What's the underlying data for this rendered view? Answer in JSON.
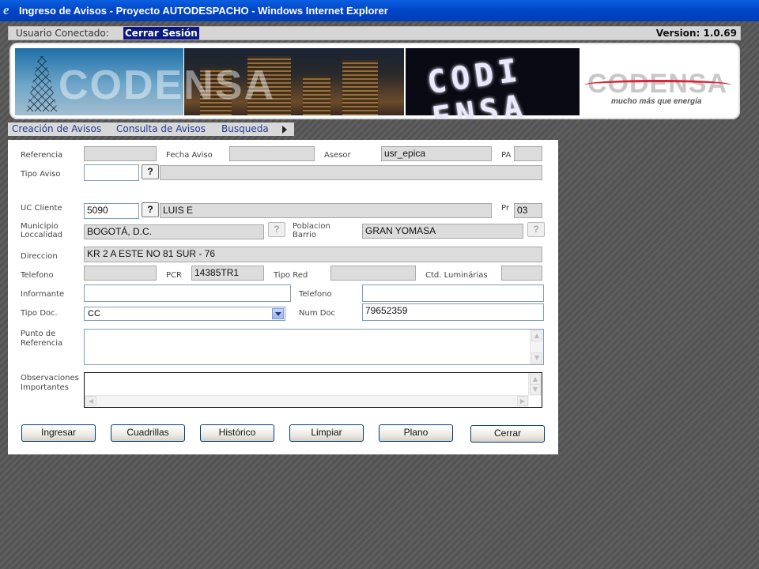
{
  "window": {
    "title": "Ingreso de Avisos - Proyecto AUTODESPACHO - Windows Internet Explorer"
  },
  "userbar": {
    "user_label": "Usuario Conectado:",
    "logout_label": "Cerrar Sesión",
    "version": "Version: 1.0.69"
  },
  "banner": {
    "watermark": "CODENSA",
    "led_text": "CODI ENSA",
    "logo_text": "CODENSA",
    "slogan": "mucho más que energía"
  },
  "menu": {
    "items": [
      "Creación de Avisos",
      "Consulta de Avisos",
      "Busqueda"
    ]
  },
  "form": {
    "labels": {
      "referencia": "Referencia",
      "fecha_aviso": "Fecha Aviso",
      "asesor": "Asesor",
      "pa": "PA",
      "tipo_aviso": "Tipo Aviso",
      "uc_cliente": "UC Cliente",
      "pr": "Pr",
      "municipio": "Municipio",
      "localidad": "Loccalidad",
      "poblacion": "Poblacion",
      "barrio": "Barrio",
      "direccion": "Direccion",
      "telefono": "Telefono",
      "pcr": "PCR",
      "tipo_red": "Tipo Red",
      "ctd_luminarias": "Ctd. Luminárias",
      "informante": "Informante",
      "telefono2": "Telefono",
      "tipo_doc": "Tipo Doc.",
      "num_doc": "Num Doc",
      "punto_ref_1": "Punto de",
      "punto_ref_2": "Referencia",
      "obs_1": "Observaciones",
      "obs_2": "Importantes"
    },
    "values": {
      "referencia": "",
      "fecha_aviso": "",
      "asesor": "usr_epica",
      "pa": "",
      "tipo_aviso": "",
      "tipo_aviso_desc": "",
      "uc_cliente": "5090",
      "cliente_nombre": "LUIS E",
      "pr": "03",
      "municipio": "BOGOTÁ, D.C.",
      "barrio": "GRAN YOMASA",
      "direccion": "KR 2 A ESTE NO 81 SUR - 76",
      "telefono": "",
      "pcr": "14385TR1",
      "tipo_red": "",
      "ctd_luminarias": "",
      "informante": "",
      "telefono2": "",
      "tipo_doc": "CC",
      "num_doc": "79652359",
      "punto_referencia": "",
      "observaciones": ""
    },
    "lookup_label": "?",
    "buttons": {
      "ingresar": "Ingresar",
      "cuadrillas": "Cuadrillas",
      "historico": "Histórico",
      "limpiar": "Limpiar",
      "plano": "Plano",
      "cerrar": "Cerrar"
    }
  },
  "colors": {
    "titlebar": "#0147c8",
    "logout_bg": "#0a1a80",
    "menu_link": "#1e3d8e",
    "logo_red": "#dd2233"
  }
}
